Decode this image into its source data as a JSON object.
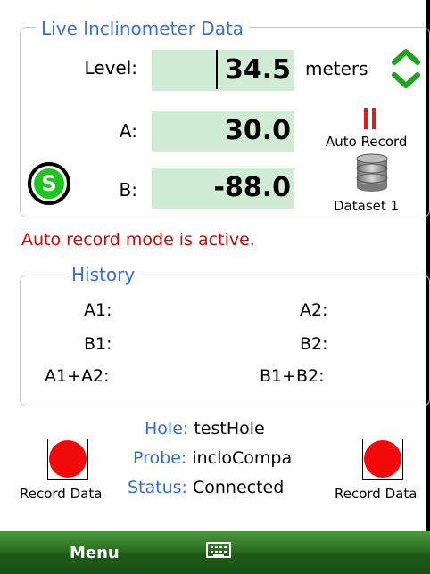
{
  "live": {
    "title": "Live Inclinometer Data",
    "level_label": "Level:",
    "level_value": "34.5",
    "level_unit": "meters",
    "a_label": "A:",
    "a_value": "30.0",
    "b_label": "B:",
    "b_value": "-88.0",
    "auto_record_label": "Auto Record",
    "dataset_label": "Dataset 1",
    "s_badge": "S"
  },
  "status_message": "Auto record mode is active.",
  "history": {
    "title": "History",
    "a1": "A1:",
    "a2": "A2:",
    "b1": "B1:",
    "b2": "B2:",
    "a1a2": "A1+A2:",
    "b1b2": "B1+B2:"
  },
  "info": {
    "hole_key": "Hole:",
    "hole_value": "testHole",
    "probe_key": "Probe:",
    "probe_value": "incloCompa",
    "status_key": "Status:",
    "status_value": "Connected"
  },
  "record_left_label": "Record Data",
  "record_right_label": "Record Data",
  "menubar": {
    "menu_label": "Menu"
  },
  "icons": [
    "chevron-updown-icon",
    "pause-icon",
    "database-icon",
    "s-status-icon",
    "record-icon",
    "keyboard-icon"
  ],
  "colors": {
    "accent_blue": "#3a6fd8",
    "value_bg": "#d1ecd5",
    "alert_red": "#e00000",
    "menubar_green": "#2b6e22"
  }
}
